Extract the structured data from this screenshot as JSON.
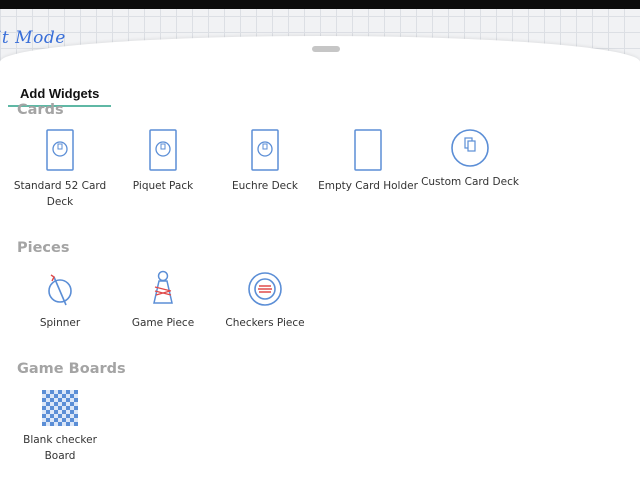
{
  "background": {
    "mode_label": "it Mode"
  },
  "sheet": {
    "title": "Add Widgets",
    "sections": [
      {
        "title": "Cards",
        "items": [
          {
            "label": "Standard 52 Card Deck",
            "icon": "card-deck-icon"
          },
          {
            "label": "Piquet Pack",
            "icon": "card-deck-icon"
          },
          {
            "label": "Euchre Deck",
            "icon": "card-deck-icon"
          },
          {
            "label": "Empty Card Holder",
            "icon": "empty-card-holder-icon"
          },
          {
            "label": "Custom Card Deck",
            "icon": "custom-card-deck-icon"
          }
        ]
      },
      {
        "title": "Pieces",
        "items": [
          {
            "label": "Spinner",
            "icon": "spinner-icon"
          },
          {
            "label": "Game Piece",
            "icon": "game-piece-icon"
          },
          {
            "label": "Checkers Piece",
            "icon": "checkers-piece-icon"
          }
        ]
      },
      {
        "title": "Game Boards",
        "items": [
          {
            "label": "Blank checker Board",
            "icon": "checker-board-icon"
          }
        ]
      }
    ]
  },
  "colors": {
    "icon_blue": "#5b8ed6",
    "accent_red": "#e04a4a",
    "underline_teal": "#5fb8a5"
  }
}
